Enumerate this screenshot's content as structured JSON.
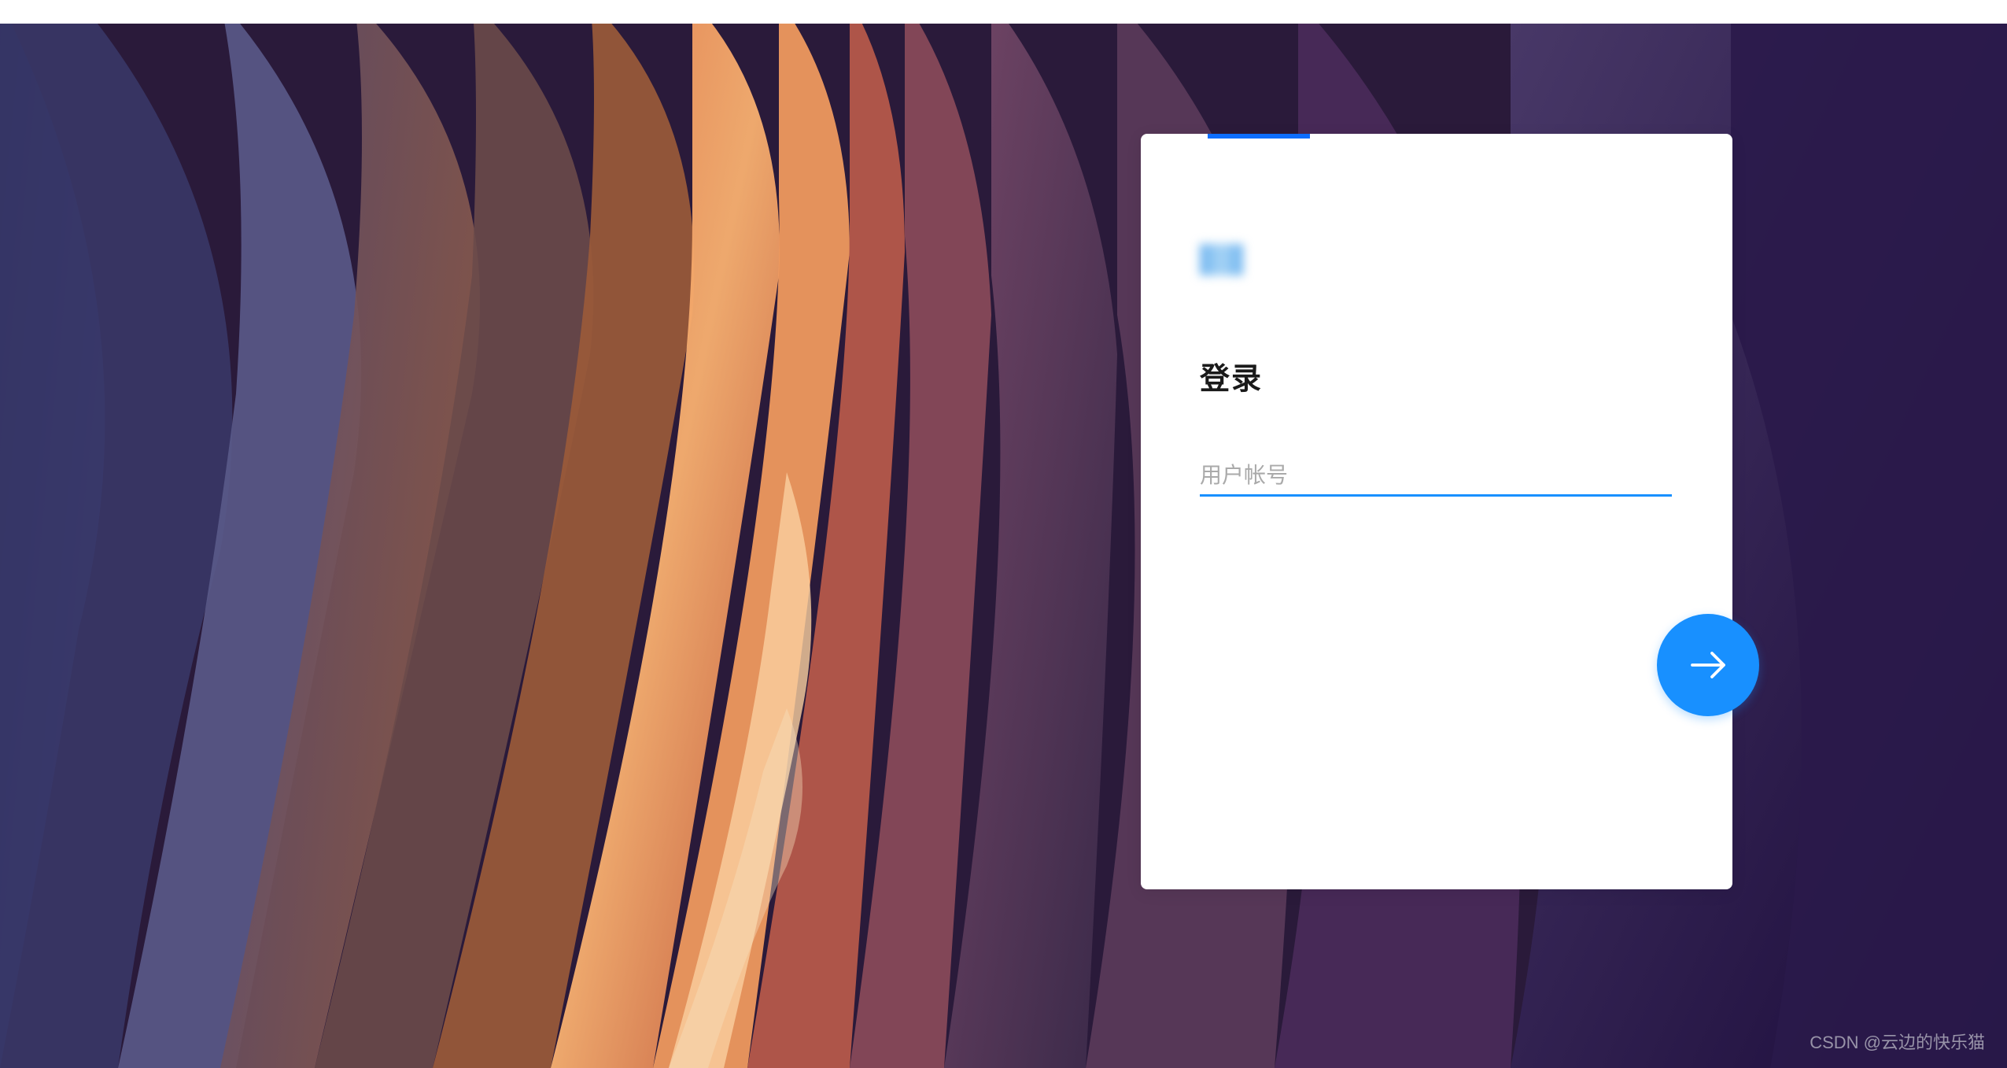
{
  "login": {
    "title": "登录",
    "username_placeholder": "用户帐号",
    "username_value": ""
  },
  "watermark": "CSDN @云边的快乐猫",
  "colors": {
    "accent": "#1890ff",
    "top_accent": "#0d6efd"
  }
}
